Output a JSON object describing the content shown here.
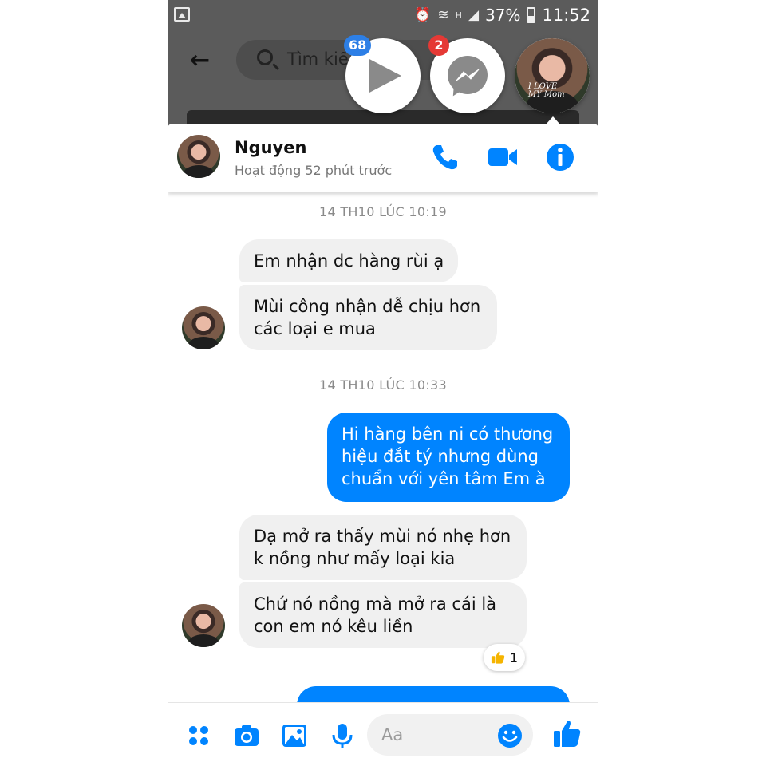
{
  "statusbar": {
    "battery": "37%",
    "time": "11:52",
    "network": "H"
  },
  "background": {
    "search_placeholder": "Tìm kiế"
  },
  "chat_heads": {
    "video_badge": "68",
    "messenger_badge": "2",
    "avatar_caption_1": "I LOVE",
    "avatar_caption_2": "MY Mom"
  },
  "conversation": {
    "contact_name": "Nguyen",
    "status": "Hoạt động 52 phút trước"
  },
  "messages": {
    "timestamp_1": "14 TH10 LÚC 10:19",
    "m1": "Em nhận dc hàng rùi ạ",
    "m2": "Mùi công nhận dễ chịu hơn\ncác loại e mua",
    "timestamp_2": "14 TH10 LÚC 10:33",
    "m3": "Hi hàng bên ni có thương\nhiệu đắt tý nhưng dùng\nchuẩn với yên tâm Em à",
    "m4": "Dạ mở ra thấy mùi nó nhẹ hơn\nk nồng như mấy loại kia",
    "m5": "Chứ nó nồng mà mở ra cái là\ncon em nó kêu liền",
    "reaction_count": "1"
  },
  "composer": {
    "placeholder": "Aa"
  },
  "colors": {
    "accent": "#0084ff",
    "incoming_bubble": "#f0f0f0",
    "badge_blue": "#2d7fe6",
    "badge_red": "#e53935"
  },
  "icons": [
    "back-arrow-icon",
    "search-icon",
    "play-icon",
    "messenger-icon",
    "phone-icon",
    "video-camera-icon",
    "info-icon",
    "thumbs-up-icon",
    "apps-icon",
    "camera-icon",
    "image-icon",
    "microphone-icon",
    "emoji-icon"
  ]
}
